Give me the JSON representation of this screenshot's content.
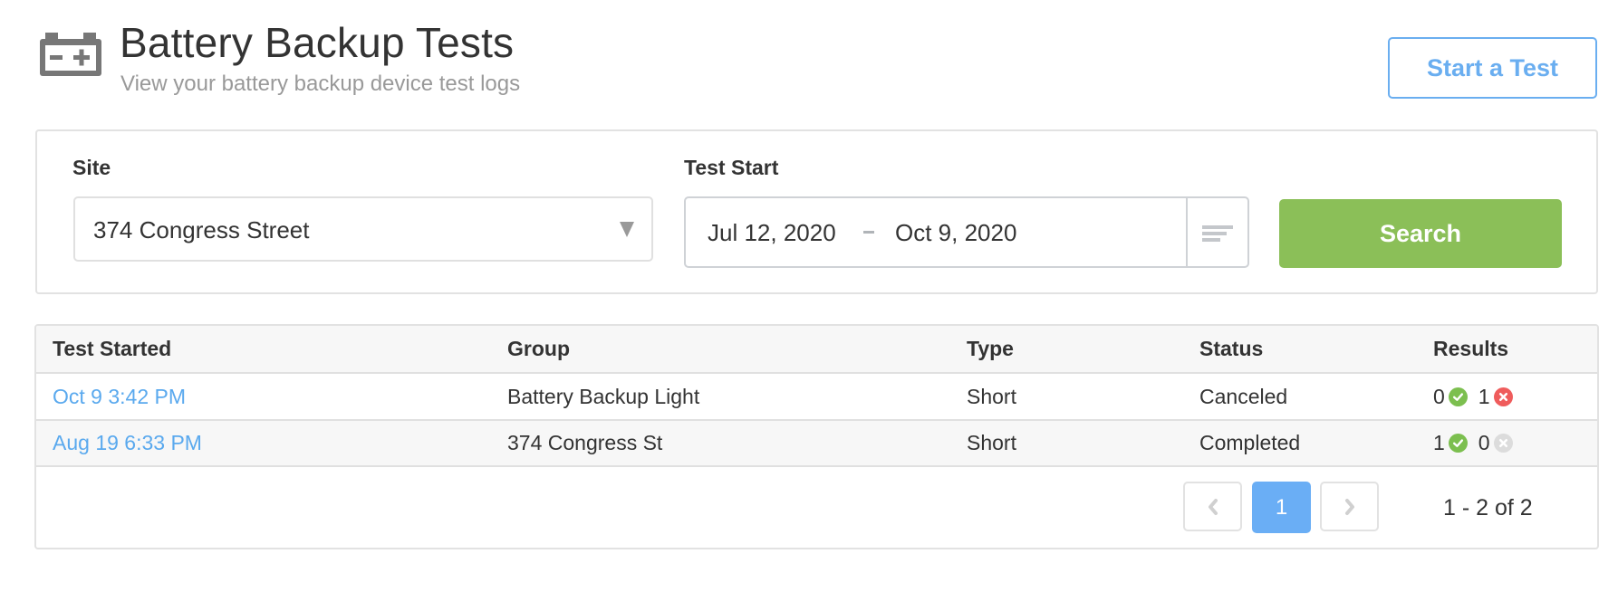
{
  "header": {
    "icon": "battery-icon",
    "title": "Battery Backup Tests",
    "subtitle": "View your battery backup device test logs",
    "start_test_label": "Start a Test"
  },
  "filters": {
    "site_label": "Site",
    "site_value": "374 Congress Street",
    "test_start_label": "Test Start",
    "date_from": "Jul 12, 2020",
    "date_to": "Oct 9, 2020",
    "search_label": "Search"
  },
  "table": {
    "columns": [
      "Test Started",
      "Group",
      "Type",
      "Status",
      "Results"
    ],
    "rows": [
      {
        "test_started": "Oct 9 3:42 PM",
        "group": "Battery Backup Light",
        "type": "Short",
        "status": "Canceled",
        "passed": "0",
        "failed": "1",
        "failed_state": "fail"
      },
      {
        "test_started": "Aug 19 6:33 PM",
        "group": "374 Congress St",
        "type": "Short",
        "status": "Completed",
        "passed": "1",
        "failed": "0",
        "failed_state": "none"
      }
    ]
  },
  "pagination": {
    "current_page": "1",
    "info": "1 - 2 of 2"
  },
  "colors": {
    "accent_blue": "#6aaef5",
    "search_green": "#8bbf58",
    "pass_green": "#7cbf4f",
    "fail_red": "#ef5c5c"
  }
}
